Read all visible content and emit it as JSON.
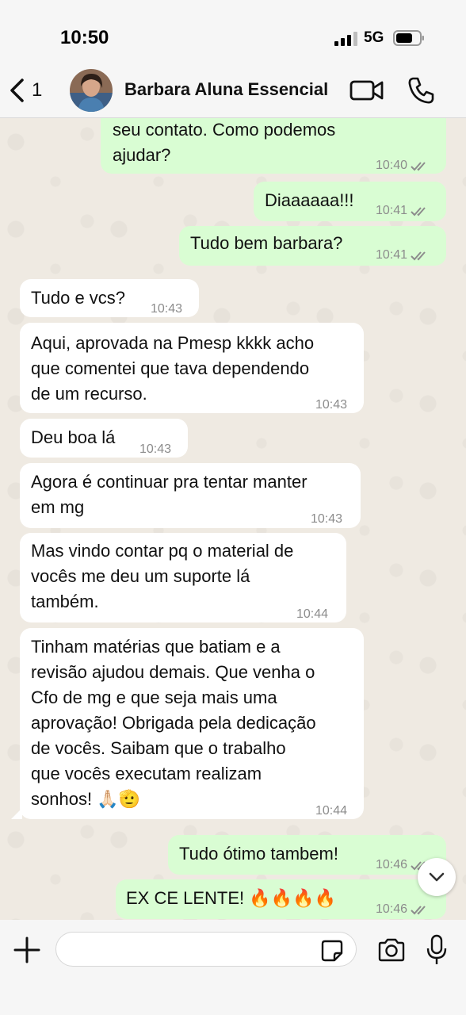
{
  "status_bar": {
    "time": "10:50",
    "network": "5G"
  },
  "header": {
    "back_count": "1",
    "contact_name": "Barbara Aluna Essencial"
  },
  "messages": [
    {
      "dir": "out",
      "text": "seu contato. Como podemos\najudar?",
      "time": "10:40"
    },
    {
      "dir": "out",
      "text": "Diaaaaaa!!!",
      "time": "10:41"
    },
    {
      "dir": "out",
      "text": "Tudo bem barbara?",
      "time": "10:41"
    },
    {
      "dir": "in",
      "text": "Tudo e vcs?",
      "time": "10:43"
    },
    {
      "dir": "in",
      "text": "Aqui, aprovada na Pmesp kkkk acho\nque comentei que tava dependendo\nde um recurso.",
      "time": "10:43"
    },
    {
      "dir": "in",
      "text": "Deu boa lá",
      "time": "10:43"
    },
    {
      "dir": "in",
      "text": "Agora é continuar pra tentar manter\nem mg",
      "time": "10:43"
    },
    {
      "dir": "in",
      "text": "Mas vindo contar pq o material de\nvocês me deu um suporte lá\ntambém.",
      "time": "10:44"
    },
    {
      "dir": "in",
      "text": "Tinham matérias que batiam e a\nrevisão ajudou demais. Que venha o\nCfo de mg e que seja mais uma\naprovação! Obrigada pela dedicação\nde vocês. Saibam que o trabalho\nque vocês executam realizam\nsonhos! 🙏🏻🫡",
      "time": "10:44"
    },
    {
      "dir": "out",
      "text": "Tudo ótimo tambem!",
      "time": "10:46"
    },
    {
      "dir": "out",
      "text": "EX CE LENTE! 🔥🔥🔥🔥",
      "time": "10:46"
    }
  ],
  "composer": {
    "placeholder": "",
    "value": ""
  },
  "colors": {
    "incoming": "#ffffff",
    "outgoing": "#d9fdd3",
    "read_ticks": "#8c8c8c",
    "background": "#efeae2"
  }
}
